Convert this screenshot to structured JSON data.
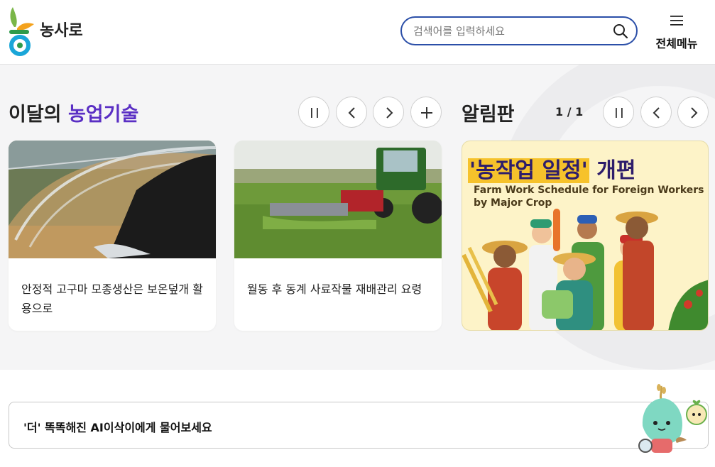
{
  "header": {
    "logo_text": "농사로",
    "search": {
      "placeholder": "검색어를 입력하세요",
      "value": ""
    },
    "menu_label": "전체메뉴"
  },
  "tech_section": {
    "title_prefix": "이달의",
    "title_highlight": "농업기술",
    "cards": [
      {
        "title": "안정적 고구마 모종생산은 보온덮개 활용으로"
      },
      {
        "title": "월동 후 동계 사료작물 재배관리 요령"
      }
    ]
  },
  "notice_section": {
    "title": "알림판",
    "page_indicator": "1 / 1",
    "banner": {
      "title_quoted": "'농작업 일정'",
      "title_suffix": "개편",
      "subtitle": "Farm Work Schedule for Foreign Workers by Major Crop"
    }
  },
  "ai_prompt": {
    "label": "'더' 똑똑해진 AI이삭이에게 물어보세요"
  },
  "colors": {
    "accent": "#5a2fc4",
    "search_border": "#2b4fa8",
    "banner_bg": "#fdf3c8"
  }
}
